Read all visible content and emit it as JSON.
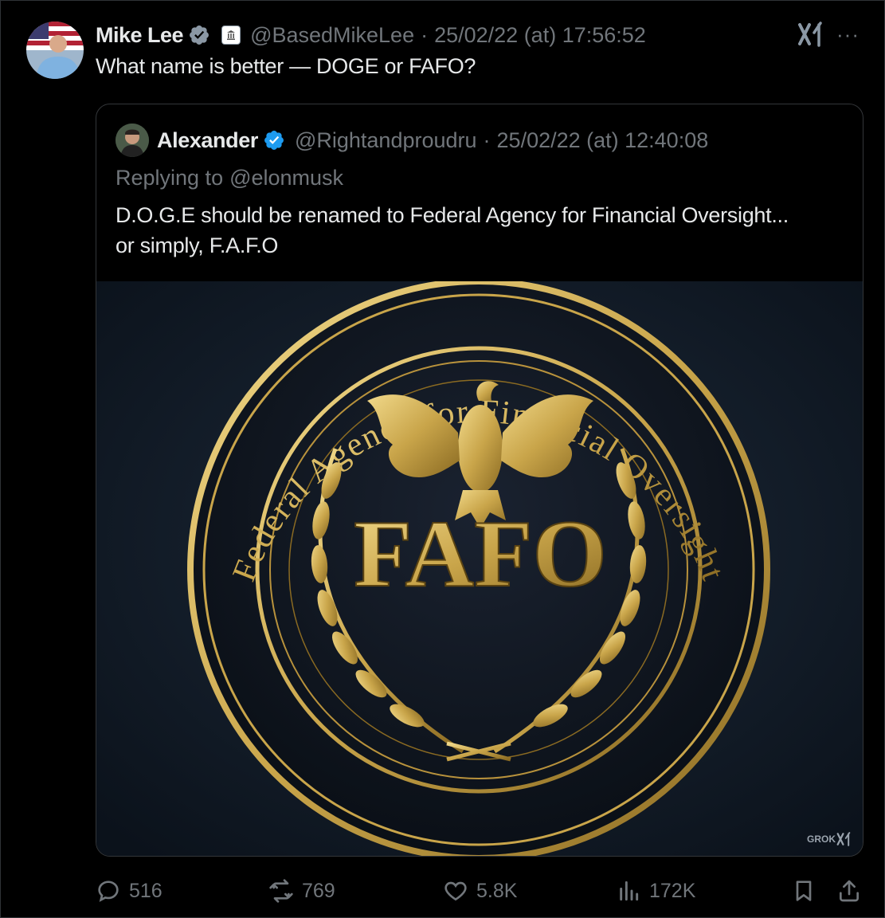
{
  "tweet": {
    "author_name": "Mike Lee",
    "author_handle": "@BasedMikeLee",
    "separator": "·",
    "timestamp": "25/02/22 (at) 17:56:52",
    "text": "What name is better — DOGE or FAFO?",
    "more_label": "···"
  },
  "quote": {
    "author_name": "Alexander",
    "author_handle": "@Rightandproudru",
    "separator": "·",
    "timestamp": "25/02/22 (at) 12:40:08",
    "replying_label": "Replying to",
    "replying_mention": "@elonmusk",
    "text_line1": "D.O.G.E should be renamed to Federal Agency for Financial Oversight...",
    "text_line2": "or simply, F.A.F.O",
    "image": {
      "seal_ring_text": "Federal Agency for Financial Oversight",
      "seal_center_text": "FAFO",
      "watermark": "GROK"
    }
  },
  "actions": {
    "replies": "516",
    "reposts": "769",
    "likes": "5.8K",
    "views": "172K"
  },
  "colors": {
    "background": "#000000",
    "text": "#e7e9ea",
    "muted": "#71767b",
    "verified": "#1d9bf0",
    "border": "#2f3336",
    "gold": "#c9a54a"
  }
}
